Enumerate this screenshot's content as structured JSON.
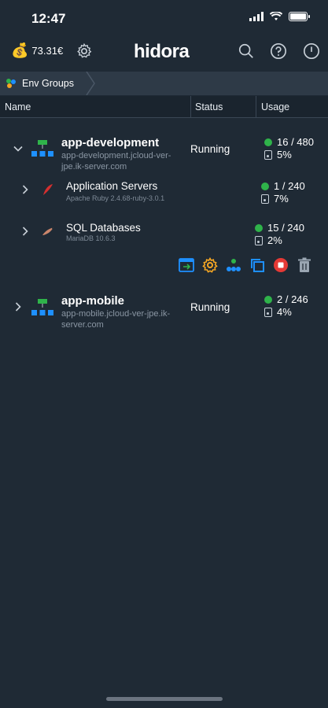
{
  "statusbar": {
    "time": "12:47"
  },
  "header": {
    "balance": "73.31€",
    "logo": "hidora"
  },
  "breadcrumb": {
    "label": "Env Groups"
  },
  "table": {
    "col_name": "Name",
    "col_status": "Status",
    "col_usage": "Usage"
  },
  "environments": [
    {
      "name": "app-development",
      "url_line1": "app-development.jcloud-ver-",
      "url_line2": "jpe.ik-server.com",
      "status": "Running",
      "cloudlets": "16 / 480",
      "disk": "5%",
      "expanded": true,
      "nodes": [
        {
          "name": "Application Servers",
          "sub": "Apache Ruby 2.4.68-ruby-3.0.1",
          "cloudlets": "1 / 240",
          "disk": "7%"
        },
        {
          "name": "SQL Databases",
          "sub": "MariaDB 10.6.3",
          "cloudlets": "15 / 240",
          "disk": "2%"
        }
      ]
    },
    {
      "name": "app-mobile",
      "url_line1": "app-mobile.jcloud-ver-jpe.ik-",
      "url_line2": "server.com",
      "status": "Running",
      "cloudlets": "2 / 246",
      "disk": "4%",
      "expanded": false
    }
  ],
  "colors": {
    "background": "#1f2a35",
    "running": "#2fb34a",
    "accent_blue": "#1e90ff",
    "accent_orange": "#f5a623",
    "stop_red": "#e53935"
  }
}
